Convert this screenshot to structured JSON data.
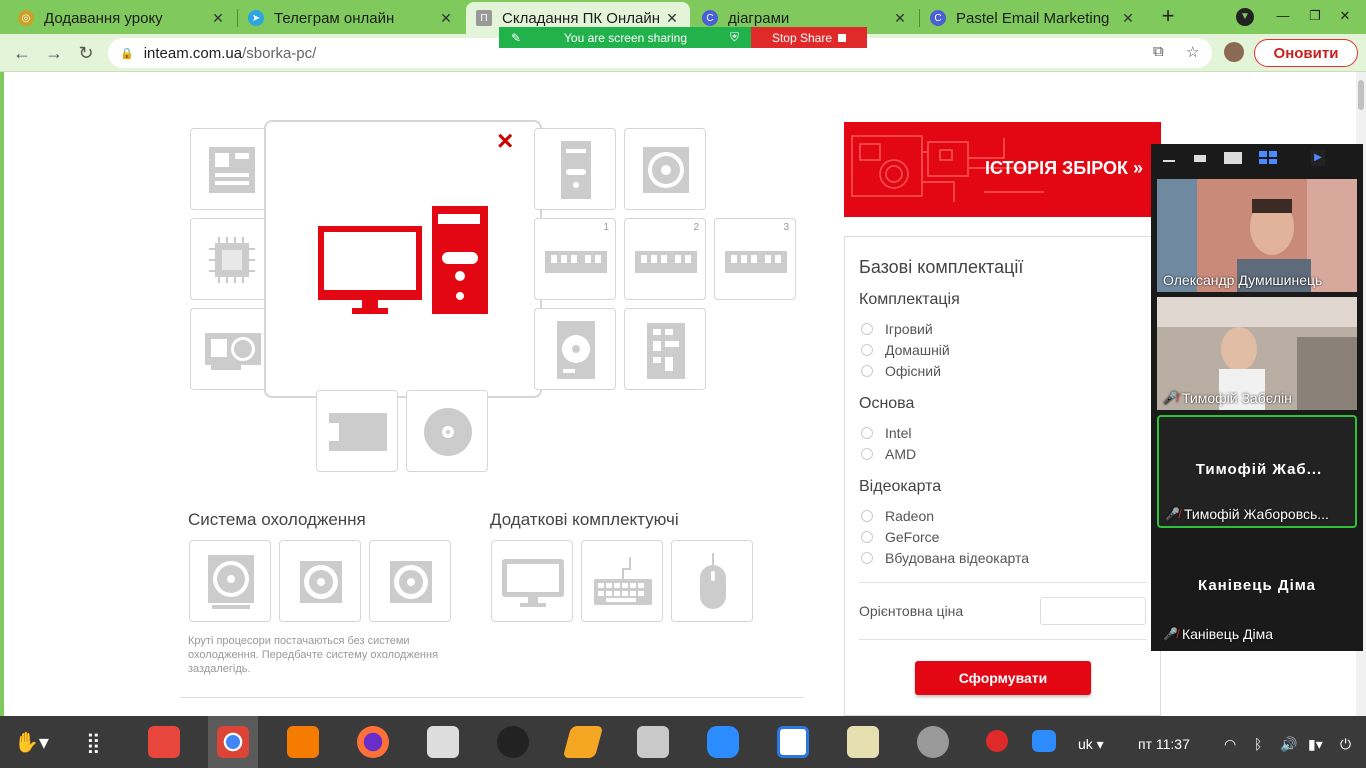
{
  "browser": {
    "tabs": [
      {
        "title": "Додавання уроку",
        "active": false
      },
      {
        "title": "Телеграм онлайн",
        "active": false
      },
      {
        "title": "Складання ПК Онлайн",
        "active": true
      },
      {
        "title": "діаграми",
        "active": false
      },
      {
        "title": "Pastel Email Marketing",
        "active": false
      }
    ],
    "new_tab_icon": "plus-icon",
    "url_domain": "inteam.com.ua",
    "url_path": "/sborka-pc/",
    "update_button": "Оновити",
    "colors": {
      "frame": "#7fc95d",
      "toolbar": "#e4f4d8"
    }
  },
  "share": {
    "status": "You are screen sharing",
    "stop_label": "Stop Share"
  },
  "page": {
    "slots_right_numbers": [
      "1",
      "2",
      "3"
    ],
    "cooling_title": "Система охолодження",
    "extras_title": "Додаткові комплектуючі",
    "cooling_note": "Круті процесори постачаються без системи охолодження. Передбачте систему охолодження заздалегідь.",
    "banner_text": "ІСТОРІЯ ЗБІРОК »",
    "accent": "#e30613"
  },
  "panel": {
    "title": "Базові комплектації",
    "groups": [
      {
        "label": "Комплектація",
        "options": [
          "Ігровий",
          "Домашній",
          "Офісний"
        ]
      },
      {
        "label": "Основа",
        "options": [
          "Intel",
          "AMD"
        ]
      },
      {
        "label": "Відеокарта",
        "options": [
          "Radeon",
          "GeForce",
          "Вбудована відеокарта"
        ]
      }
    ],
    "price_label": "Орієнтовна ціна",
    "price_value": "",
    "submit": "Сформувати"
  },
  "zoom": {
    "participants": [
      {
        "name": "Олександр Думишинець",
        "muted": false,
        "video": true
      },
      {
        "name": "Тимофій Забєлін",
        "muted": true,
        "video": true
      },
      {
        "name": "Тимофій Жаборовсь...",
        "display": "Тимофій Жаб...",
        "muted": true,
        "video": false,
        "speaking": true
      },
      {
        "name": "Канівець Діма",
        "display": "Канівець Діма",
        "muted": true,
        "video": false
      }
    ]
  },
  "taskbar": {
    "lang": "uk",
    "clock": "пт 11:37"
  }
}
